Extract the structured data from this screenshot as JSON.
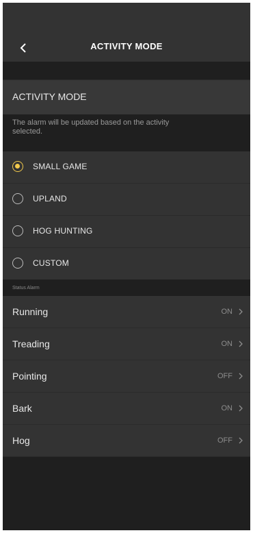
{
  "header": {
    "title": "ACTIVITY MODE",
    "back_icon": "chevron-left-icon"
  },
  "section": {
    "title": "ACTIVITY MODE",
    "description": "The alarm will be updated based on the activity selected."
  },
  "modes": [
    {
      "label": "SMALL GAME",
      "selected": true
    },
    {
      "label": "UPLAND",
      "selected": false
    },
    {
      "label": "HOG HUNTING",
      "selected": false
    },
    {
      "label": "CUSTOM",
      "selected": false
    }
  ],
  "status_alarm": {
    "caption": "Status Alarm",
    "items": [
      {
        "label": "Running",
        "value": "ON"
      },
      {
        "label": "Treading",
        "value": "ON"
      },
      {
        "label": "Pointing",
        "value": "OFF"
      },
      {
        "label": "Bark",
        "value": "ON"
      },
      {
        "label": "Hog",
        "value": "OFF"
      }
    ]
  },
  "colors": {
    "accent": "#f2c94c",
    "background": "#252525",
    "row": "#333333"
  }
}
